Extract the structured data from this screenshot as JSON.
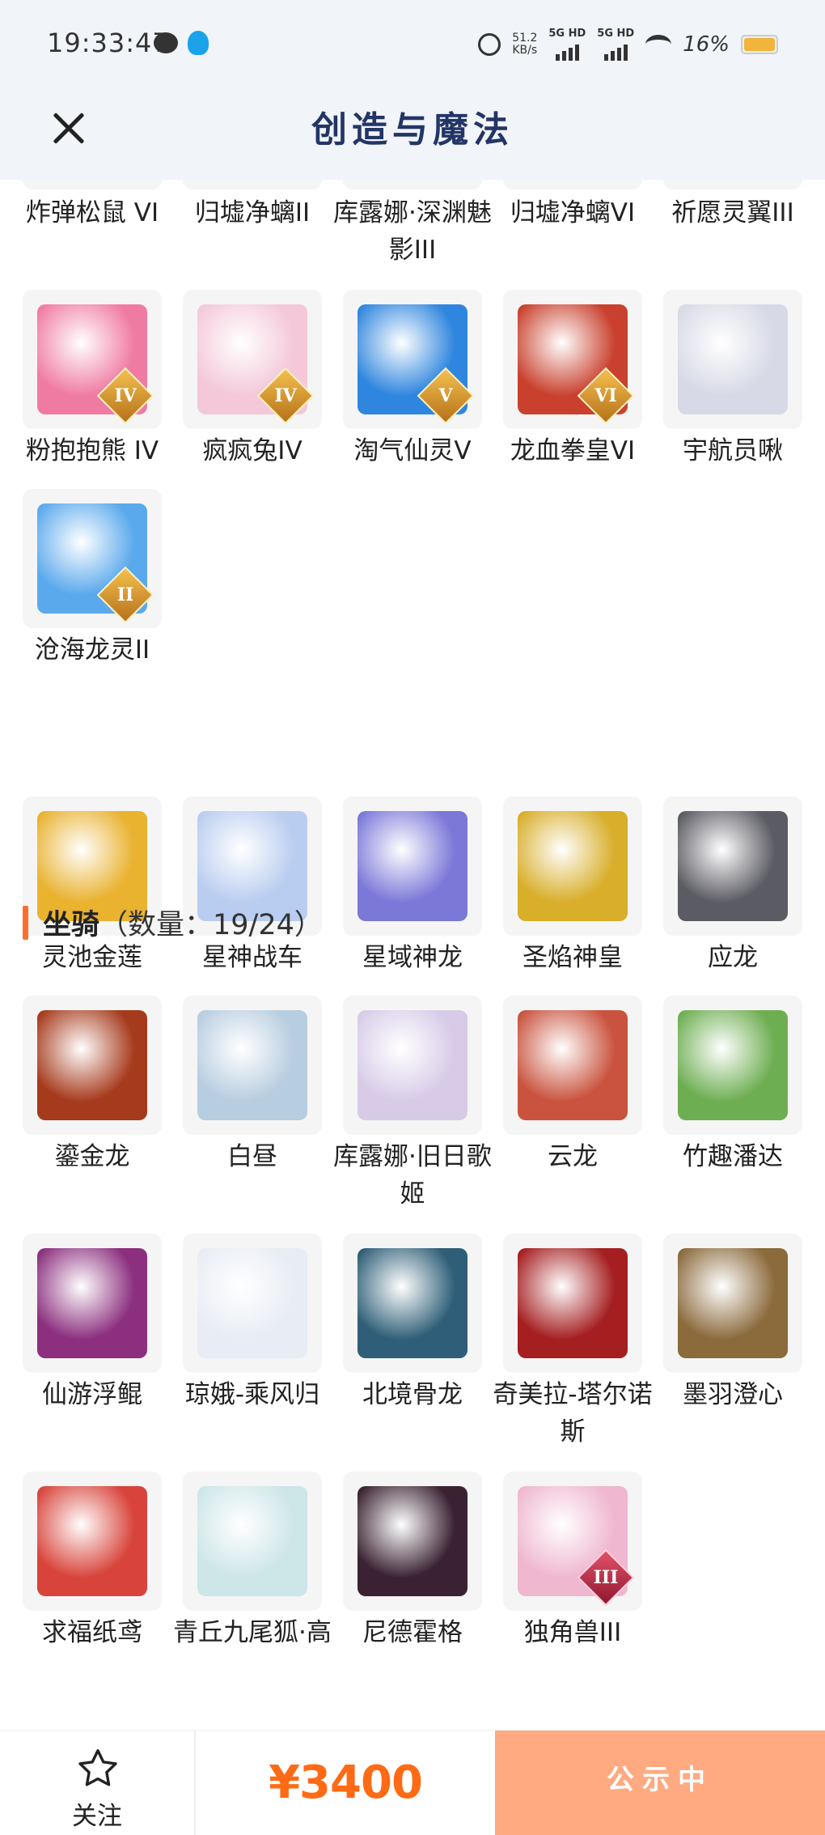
{
  "status_bar": {
    "time": "19:33:47",
    "net_speed_value": "51.2",
    "net_speed_unit": "KB/s",
    "sim1": "5G HD",
    "sim2": "5G HD",
    "battery": "16%",
    "icons": [
      "message-icon",
      "qq-icon",
      "alarm-icon",
      "signal-icon",
      "wifi-icon",
      "battery-icon"
    ]
  },
  "header": {
    "title": "创造与魔法",
    "close_icon": "close-icon"
  },
  "pets_tail": {
    "top_row": [
      "炸弹松鼠 VI",
      "归墟净螭II",
      "库露娜·深渊魅影III",
      "归墟净螭VI",
      "祈愿灵翼III"
    ],
    "items": [
      {
        "name": "粉抱抱熊 IV",
        "badge": "IV",
        "color": "#f07ba2"
      },
      {
        "name": "疯疯兔IV",
        "badge": "IV",
        "color": "#f4c8d9"
      },
      {
        "name": "淘气仙灵V",
        "badge": "V",
        "color": "#2f86de"
      },
      {
        "name": "龙血拳皇VI",
        "badge": "VI",
        "color": "#c9412e"
      },
      {
        "name": "宇航员啾",
        "badge": "",
        "color": "#d7d9e6"
      },
      {
        "name": "沧海龙灵II",
        "badge": "II",
        "color": "#5aa9ec"
      }
    ]
  },
  "mounts": {
    "title": "坐骑",
    "count_label": "（数量：19/24）",
    "items": [
      {
        "name": "灵池金莲",
        "badge": "",
        "color": "#e9b22f"
      },
      {
        "name": "星神战车",
        "badge": "",
        "color": "#b9cdf0"
      },
      {
        "name": "星域神龙",
        "badge": "",
        "color": "#7b78d8"
      },
      {
        "name": "圣焰神皇",
        "badge": "",
        "color": "#d8ae2a"
      },
      {
        "name": "应龙",
        "badge": "",
        "color": "#5b5b63"
      },
      {
        "name": "鎏金龙",
        "badge": "",
        "color": "#a63a1c"
      },
      {
        "name": "白昼",
        "badge": "",
        "color": "#b7cde0"
      },
      {
        "name": "库露娜·旧日歌姬",
        "badge": "",
        "color": "#d7cbe8"
      },
      {
        "name": "云龙",
        "badge": "",
        "color": "#c9533e"
      },
      {
        "name": "竹趣潘达",
        "badge": "",
        "color": "#6eae52"
      },
      {
        "name": "仙游浮鲲",
        "badge": "",
        "color": "#8b2f7e"
      },
      {
        "name": "琼娥-乘风归",
        "badge": "",
        "color": "#e8ecf4"
      },
      {
        "name": "北境骨龙",
        "badge": "",
        "color": "#2f5f78"
      },
      {
        "name": "奇美拉-塔尔诺斯",
        "badge": "",
        "color": "#a51e20"
      },
      {
        "name": "墨羽澄心",
        "badge": "",
        "color": "#8b6a3c"
      },
      {
        "name": "求福纸鸢",
        "badge": "",
        "color": "#d8443b"
      },
      {
        "name": "青丘九尾狐·高",
        "badge": "",
        "color": "#cde6e8"
      },
      {
        "name": "尼德霍格",
        "badge": "",
        "color": "#3a2232"
      },
      {
        "name": "独角兽III",
        "badge": "III",
        "color": "#efb7d0"
      }
    ]
  },
  "bottom_bar": {
    "follow_label": "关注",
    "follow_icon": "star-icon",
    "price": "¥3400",
    "status_button": "公示中",
    "price_color": "#ff6a14",
    "button_color": "#ffaa80"
  }
}
